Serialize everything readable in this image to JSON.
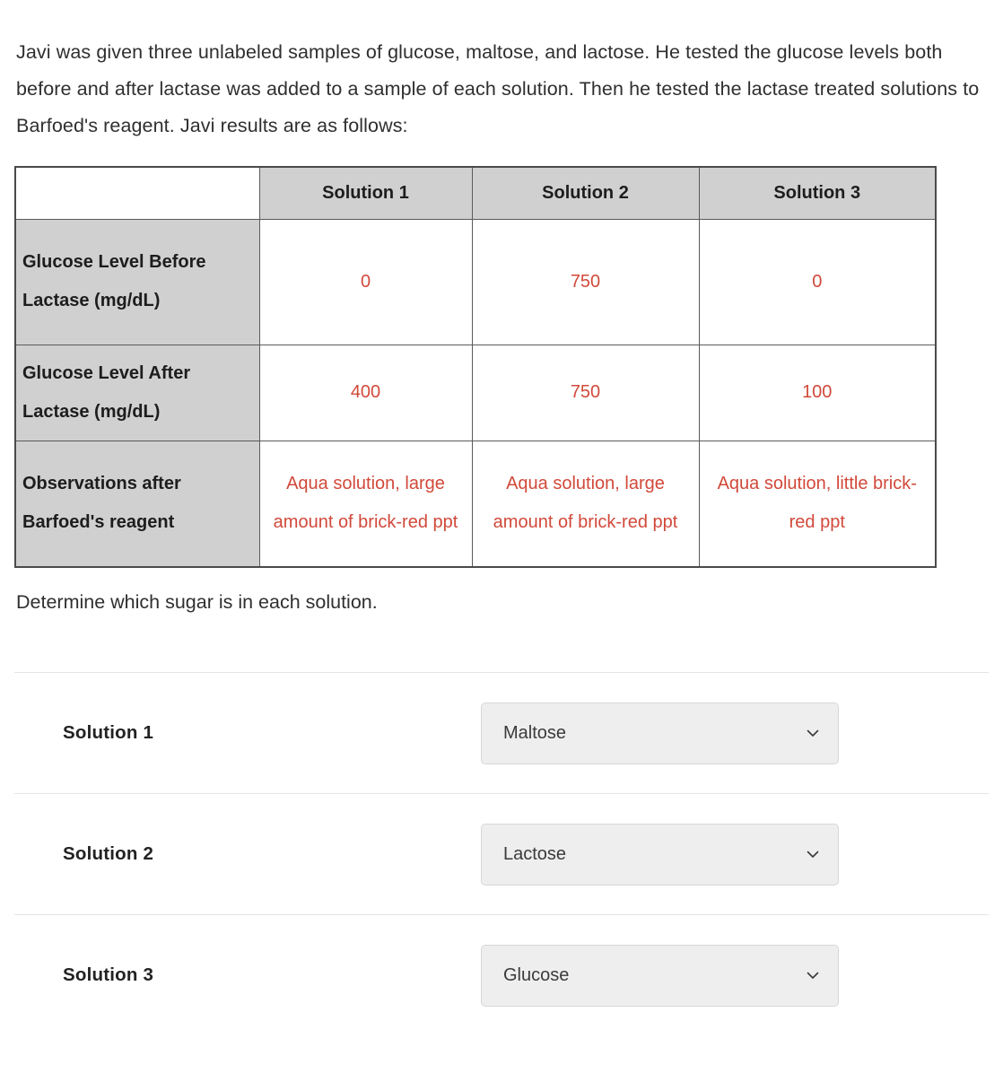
{
  "problem": {
    "intro": "Javi was given three unlabeled samples of glucose, maltose, and lactose. He tested the glucose levels both before and after lactase was added to a sample of each solution. Then he tested the lactase treated solutions to Barfoed's reagent. Javi results are as follows:",
    "prompt": "Determine which sugar is in each solution."
  },
  "table": {
    "corner_label": "",
    "columns": [
      "Solution 1",
      "Solution 2",
      "Solution 3"
    ],
    "rows": [
      {
        "header": "Glucose Level Before Lactase (mg/dL)",
        "values": [
          "0",
          "750",
          "0"
        ]
      },
      {
        "header": "Glucose Level After Lactase (mg/dL)",
        "values": [
          "400",
          "750",
          "100"
        ]
      },
      {
        "header": "Observations after Barfoed's reagent",
        "values": [
          "Aqua solution, large amount of brick-red ppt",
          "Aqua solution, large amount of brick-red ppt",
          "Aqua solution, little brick-red ppt"
        ]
      }
    ]
  },
  "answers": [
    {
      "label": "Solution 1",
      "selected": "Maltose",
      "icon": "chevron-down-icon"
    },
    {
      "label": "Solution 2",
      "selected": "Lactose",
      "icon": "chevron-down-icon"
    },
    {
      "label": "Solution 3",
      "selected": "Glucose",
      "icon": "chevron-down-icon"
    }
  ],
  "colors": {
    "answer_text": "#d1493a",
    "header_fill": "#d0d0d0",
    "table_border": "#5a5a5a",
    "select_fill": "#eeeeee",
    "divider": "#e4e4e4",
    "body_text": "#2f2f2f"
  }
}
